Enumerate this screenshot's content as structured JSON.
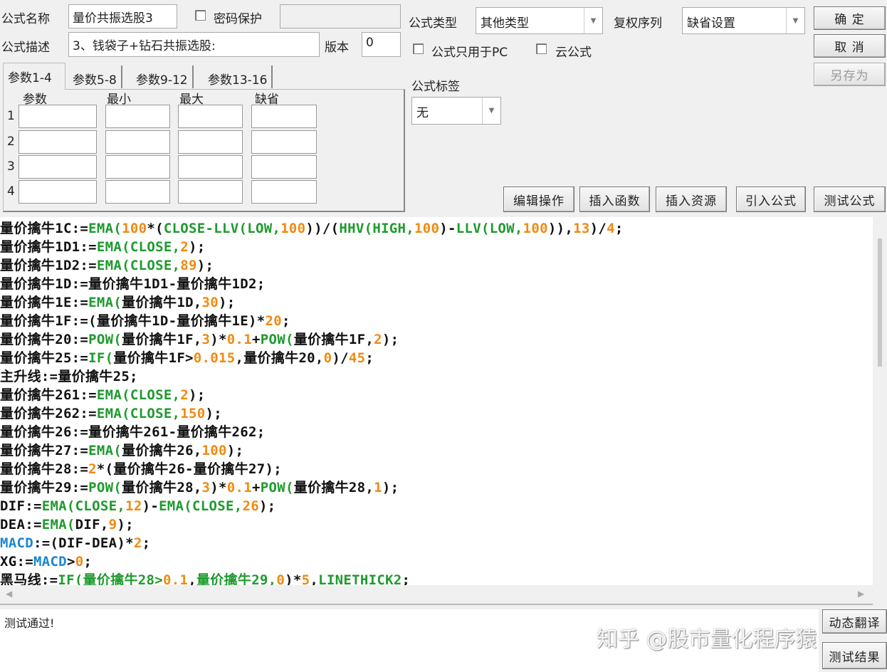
{
  "header": {
    "name_label": "公式名称",
    "name_value": "量价共振选股3",
    "password_label": "密码保护",
    "password_checked": false,
    "password_value": "",
    "desc_label": "公式描述",
    "desc_value": "3、钱袋子+钻石共振选股:",
    "version_label": "版本",
    "version_value": "0",
    "type_label": "公式类型",
    "type_value": "其他类型",
    "adjust_label": "复权序列",
    "adjust_value": "缺省设置",
    "pc_only_label": "公式只用于PC",
    "pc_only_checked": false,
    "cloud_label": "云公式",
    "cloud_checked": false,
    "tag_label": "公式标签",
    "tag_value": "无"
  },
  "buttons": {
    "ok": "确 定",
    "cancel": "取 消",
    "save_as": "另存为",
    "edit_ops": "编辑操作",
    "insert_func": "插入函数",
    "insert_res": "插入资源",
    "import_formula": "引入公式",
    "test_formula": "测试公式",
    "dyn_translate": "动态翻译",
    "test_result": "测试结果"
  },
  "params": {
    "tabs": [
      "参数1-4",
      "参数5-8",
      "参数9-12",
      "参数13-16"
    ],
    "active_tab": 0,
    "columns": [
      "参数",
      "最小",
      "最大",
      "缺省"
    ],
    "rows": [
      "1",
      "2",
      "3",
      "4"
    ]
  },
  "colors": {
    "function": "#1e9a2e",
    "number": "#f08a10",
    "keyword": "#1c86d0",
    "text": "#111111"
  },
  "code": [
    [
      [
        "量价擒牛1C:=",
        ""
      ],
      [
        "EMA(",
        "f"
      ],
      [
        "100",
        "n"
      ],
      [
        "*(",
        ""
      ],
      [
        "CLOSE-LLV(LOW,",
        "f"
      ],
      [
        "100",
        "n"
      ],
      [
        "))/(",
        ""
      ],
      [
        "HHV(HIGH,",
        "f"
      ],
      [
        "100",
        "n"
      ],
      [
        ")-",
        ""
      ],
      [
        "LLV(LOW,",
        "f"
      ],
      [
        "100",
        "n"
      ],
      [
        ")),",
        ""
      ],
      [
        "13",
        "n"
      ],
      [
        ")/",
        ""
      ],
      [
        "4",
        "n"
      ],
      [
        ";",
        ""
      ]
    ],
    [
      [
        "量价擒牛1D1:=",
        ""
      ],
      [
        "EMA(CLOSE,",
        "f"
      ],
      [
        "2",
        "n"
      ],
      [
        ");",
        ""
      ]
    ],
    [
      [
        "量价擒牛1D2:=",
        ""
      ],
      [
        "EMA(CLOSE,",
        "f"
      ],
      [
        "89",
        "n"
      ],
      [
        ");",
        ""
      ]
    ],
    [
      [
        "量价擒牛1D:=量价擒牛1D1-量价擒牛1D2;",
        ""
      ]
    ],
    [
      [
        "量价擒牛1E:=",
        ""
      ],
      [
        "EMA(",
        "f"
      ],
      [
        "量价擒牛1D,",
        ""
      ],
      [
        "30",
        "n"
      ],
      [
        ");",
        ""
      ]
    ],
    [
      [
        "量价擒牛1F:=(量价擒牛1D-量价擒牛1E)*",
        ""
      ],
      [
        "20",
        "n"
      ],
      [
        ";",
        ""
      ]
    ],
    [
      [
        "量价擒牛20:=",
        ""
      ],
      [
        "POW(",
        "f"
      ],
      [
        "量价擒牛1F,",
        ""
      ],
      [
        "3",
        "n"
      ],
      [
        ")*",
        ""
      ],
      [
        "0.1",
        "n"
      ],
      [
        "+",
        ""
      ],
      [
        "POW(",
        "f"
      ],
      [
        "量价擒牛1F,",
        ""
      ],
      [
        "2",
        "n"
      ],
      [
        ");",
        ""
      ]
    ],
    [
      [
        "量价擒牛25:=",
        ""
      ],
      [
        "IF(",
        "f"
      ],
      [
        "量价擒牛1F>",
        ""
      ],
      [
        "0.015",
        "n"
      ],
      [
        ",量价擒牛20,",
        ""
      ],
      [
        "0",
        "n"
      ],
      [
        ")/",
        ""
      ],
      [
        "45",
        "n"
      ],
      [
        ";",
        ""
      ]
    ],
    [
      [
        "主升线:=量价擒牛25;",
        ""
      ]
    ],
    [
      [
        "量价擒牛261:=",
        ""
      ],
      [
        "EMA(CLOSE,",
        "f"
      ],
      [
        "2",
        "n"
      ],
      [
        ");",
        ""
      ]
    ],
    [
      [
        "量价擒牛262:=",
        ""
      ],
      [
        "EMA(CLOSE,",
        "f"
      ],
      [
        "150",
        "n"
      ],
      [
        ");",
        ""
      ]
    ],
    [
      [
        "量价擒牛26:=量价擒牛261-量价擒牛262;",
        ""
      ]
    ],
    [
      [
        "量价擒牛27:=",
        ""
      ],
      [
        "EMA(",
        "f"
      ],
      [
        "量价擒牛26,",
        ""
      ],
      [
        "100",
        "n"
      ],
      [
        ");",
        ""
      ]
    ],
    [
      [
        "量价擒牛28:=",
        ""
      ],
      [
        "2",
        "n"
      ],
      [
        "*(量价擒牛26-量价擒牛27);",
        ""
      ]
    ],
    [
      [
        "量价擒牛29:=",
        ""
      ],
      [
        "POW(",
        "f"
      ],
      [
        "量价擒牛28,",
        ""
      ],
      [
        "3",
        "n"
      ],
      [
        ")*",
        ""
      ],
      [
        "0.1",
        "n"
      ],
      [
        "+",
        ""
      ],
      [
        "POW(",
        "f"
      ],
      [
        "量价擒牛28,",
        ""
      ],
      [
        "1",
        "n"
      ],
      [
        ");",
        ""
      ]
    ],
    [
      [
        "DIF:=",
        ""
      ],
      [
        "EMA(CLOSE,",
        "f"
      ],
      [
        "12",
        "n"
      ],
      [
        ")-",
        ""
      ],
      [
        "EMA(CLOSE,",
        "f"
      ],
      [
        "26",
        "n"
      ],
      [
        ");",
        ""
      ]
    ],
    [
      [
        "DEA:=",
        ""
      ],
      [
        "EMA(",
        "f"
      ],
      [
        "DIF,",
        ""
      ],
      [
        "9",
        "n"
      ],
      [
        ");",
        ""
      ]
    ],
    [
      [
        "MACD",
        "m"
      ],
      [
        ":=(DIF-DEA)*",
        ""
      ],
      [
        "2",
        "n"
      ],
      [
        ";",
        ""
      ]
    ],
    [
      [
        "XG:=",
        ""
      ],
      [
        "MACD",
        "m"
      ],
      [
        ">",
        ""
      ],
      [
        "0",
        "n"
      ],
      [
        ";",
        ""
      ]
    ],
    [
      [
        "黑马线:=",
        ""
      ],
      [
        "IF(量价擒牛28>",
        "f"
      ],
      [
        "0.1",
        "n"
      ],
      [
        ",",
        ""
      ],
      [
        "量价擒牛29,",
        "f"
      ],
      [
        "0",
        "n"
      ],
      [
        ")*",
        ""
      ],
      [
        "5",
        "n"
      ],
      [
        ",",
        ""
      ],
      [
        "LINETHICK2",
        "f"
      ],
      [
        ";",
        ""
      ]
    ]
  ],
  "output": {
    "text": "测试通过!"
  },
  "watermark": "知乎 @股市量化程序猿"
}
